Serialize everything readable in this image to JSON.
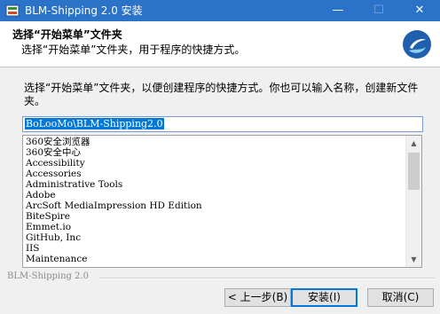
{
  "window": {
    "title": "BLM-Shipping 2.0 安装",
    "minimize_glyph": "—",
    "maximize_glyph": "☐",
    "close_glyph": "✕"
  },
  "header": {
    "title": "选择“开始菜单”文件夹",
    "subtitle": "选择“开始菜单”文件夹，用于程序的快捷方式。"
  },
  "description": "选择“开始菜单”文件夹，以便创建程序的快捷方式。你也可以输入名称，创建新文件夹。",
  "folder_input": {
    "value": "BoLooMo\\BLM-Shipping2.0"
  },
  "folder_list": [
    "360安全浏览器",
    "360安全中心",
    "Accessibility",
    "Accessories",
    "Administrative Tools",
    "Adobe",
    "ArcSoft MediaImpression HD Edition",
    "BiteSpire",
    "Emmet.io",
    "GitHub, Inc",
    "IIS",
    "Maintenance"
  ],
  "footer": {
    "brand": "BLM-Shipping 2.0"
  },
  "buttons": {
    "back": "< 上一步(B)",
    "install": "安装(I)",
    "cancel": "取消(C)"
  },
  "colors": {
    "titlebar": "#2a73c9",
    "selection": "#0078d7"
  }
}
